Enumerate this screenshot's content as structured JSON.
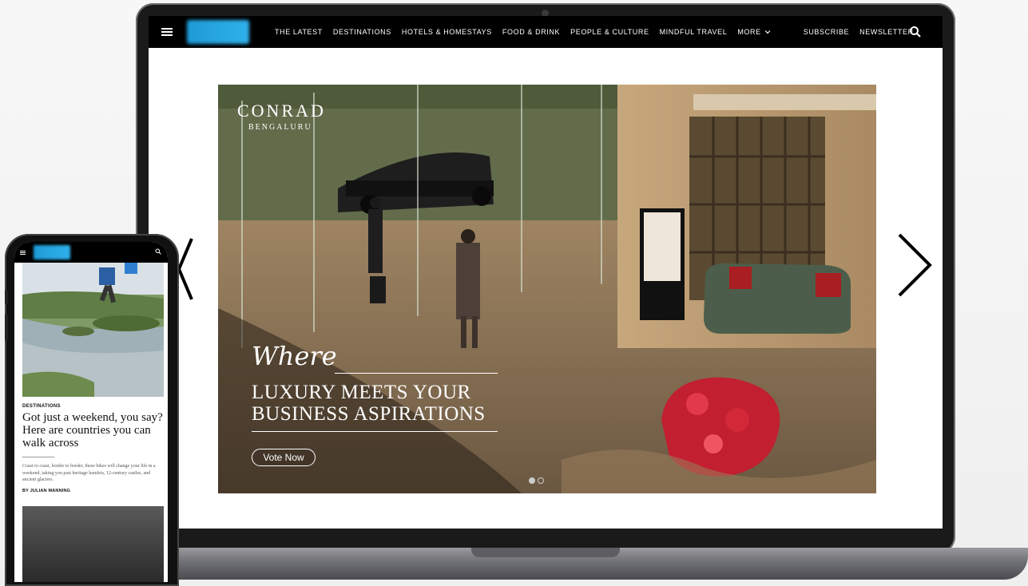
{
  "site": {
    "nav": {
      "links": [
        "THE LATEST",
        "DESTINATIONS",
        "HOTELS & HOMESTAYS",
        "FOOD & DRINK",
        "PEOPLE & CULTURE",
        "MINDFUL TRAVEL"
      ],
      "more_label": "MORE",
      "right_links": [
        "SUBSCRIBE",
        "NEWSLETTER"
      ],
      "search_icon": "search-icon",
      "menu_icon": "hamburger-icon"
    }
  },
  "hero": {
    "brand_name": "CONRAD",
    "brand_city": "BENGALURU",
    "script_text": "Where",
    "tagline_line1": "LUXURY MEETS YOUR",
    "tagline_line2": "BUSINESS ASPIRATIONS",
    "cta_label": "Vote Now",
    "slide_count": 2,
    "active_slide": 1
  },
  "phone": {
    "section": "DESTINATIONS",
    "headline": "Got just a weekend, you say? Here are countries you can walk across",
    "summary": "Coast to coast, border to border, these hikes will change your life in a weekend, taking you past heritage hamlets, 12-century castles, and ancient glaciers.",
    "byline": "BY JULIAN MANNING"
  },
  "colors": {
    "nav_bg": "#000000",
    "logo_blue": "#1e9bd7",
    "laptop_frame": "#1a1a1a"
  }
}
